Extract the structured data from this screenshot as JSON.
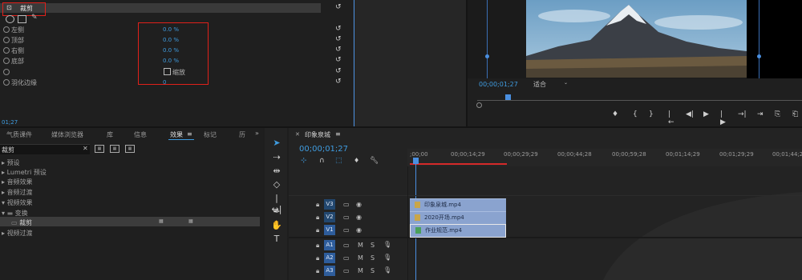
{
  "effect_controls": {
    "effect_name": "裁剪",
    "properties": [
      {
        "label": "左侧",
        "value": "0.0 %"
      },
      {
        "label": "顶部",
        "value": "0.0 %"
      },
      {
        "label": "右侧",
        "value": "0.0 %"
      },
      {
        "label": "底部",
        "value": "0.0 %"
      },
      {
        "label": "",
        "value": ""
      },
      {
        "label": "羽化边缘",
        "value": "0"
      }
    ],
    "zoom_checkbox_label": "缩放",
    "timecode": "01;27"
  },
  "program_monitor": {
    "timecode": "00;00;01;27",
    "fit_label": "适合",
    "controls": [
      "♦",
      "{",
      "}",
      "|←",
      "◀|",
      "▶",
      "|▶",
      "→|",
      "⇥",
      "⎘",
      "⎗",
      "📷"
    ]
  },
  "project_panel": {
    "tabs": [
      "气质课件",
      "媒体浏览器",
      "库",
      "信息",
      "效果",
      "标记",
      "历"
    ],
    "active_tab": "效果",
    "search_value": "裁剪",
    "tree": [
      {
        "label": "预设",
        "indent": 0
      },
      {
        "label": "Lumetri 预设",
        "indent": 0
      },
      {
        "label": "音频效果",
        "indent": 0
      },
      {
        "label": "音频过渡",
        "indent": 0
      },
      {
        "label": "视频效果",
        "indent": 0
      },
      {
        "label": "变换",
        "indent": 1
      },
      {
        "label": "裁剪",
        "indent": 2
      },
      {
        "label": "视频过渡",
        "indent": 0
      }
    ]
  },
  "timeline": {
    "sequence_name": "印象泉城",
    "timecode": "00;00;01;27",
    "ruler": [
      ";00;00",
      "00;00;14;29",
      "00;00;29;29",
      "00;00;44;28",
      "00;00;59;28",
      "00;01;14;29",
      "00;01;29;29",
      "00;01;44;28"
    ],
    "video_tracks": [
      {
        "name": "V3",
        "clip": "印象泉城.mp4"
      },
      {
        "name": "V2",
        "clip": "2020开场.mp4"
      },
      {
        "name": "V1",
        "clip": "作业规范.mp4"
      }
    ],
    "audio_tracks": [
      {
        "name": "A1",
        "m": "M",
        "s": "S"
      },
      {
        "name": "A2",
        "m": "M",
        "s": "S"
      },
      {
        "name": "A3",
        "m": "M",
        "s": "S"
      }
    ]
  }
}
